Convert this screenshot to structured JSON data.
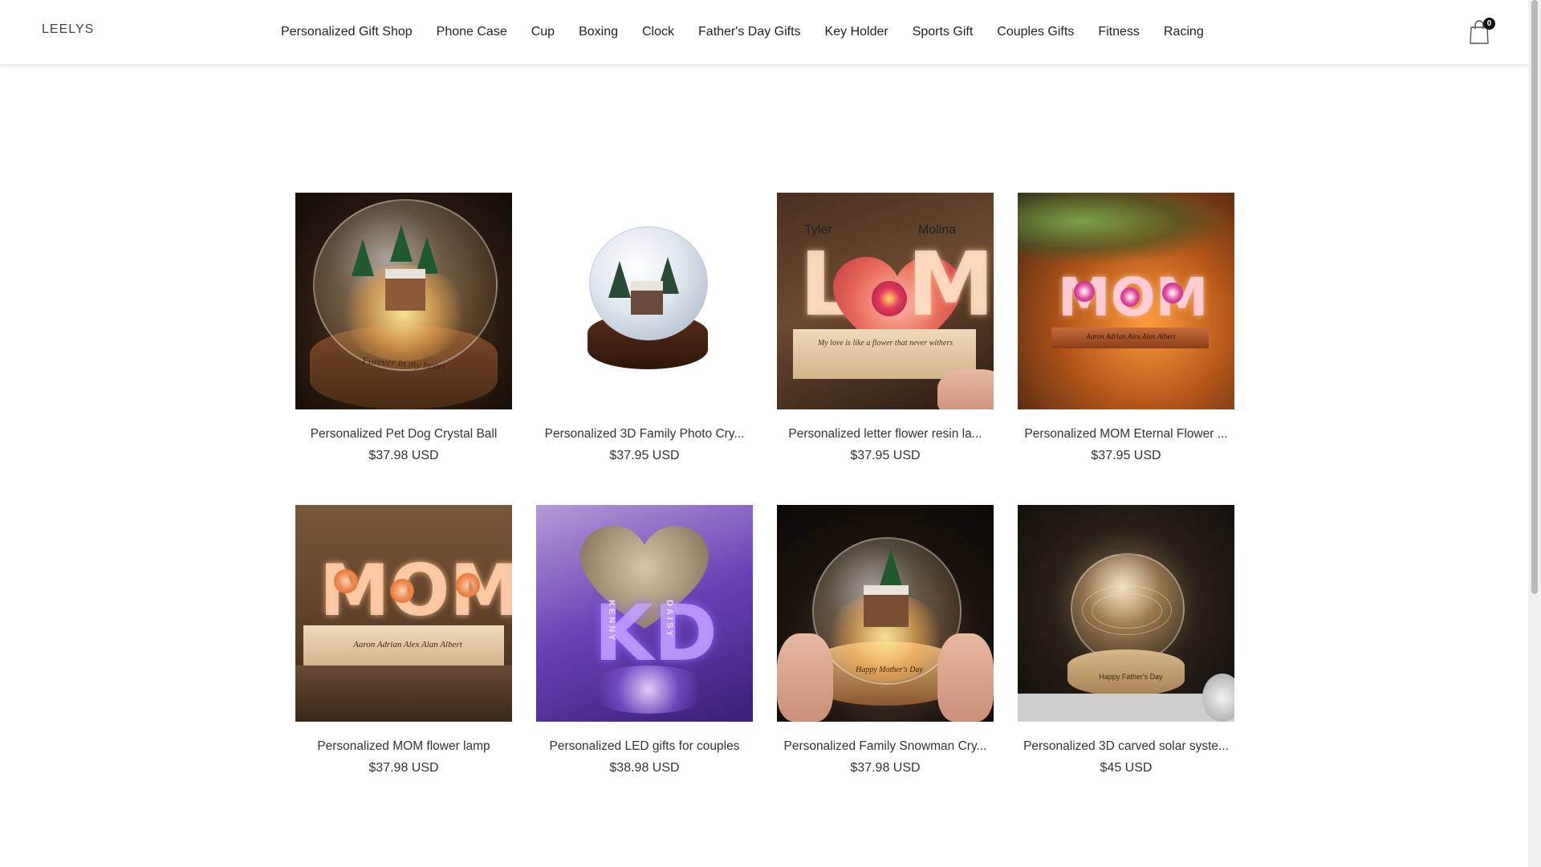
{
  "header": {
    "logo": "LEELYS",
    "nav": [
      "Personalized Gift Shop",
      "Phone Case",
      "Cup",
      "Boxing",
      "Clock",
      "Father's Day Gifts",
      "Key Holder",
      "Sports Gift",
      "Couples Gifts",
      "Fitness",
      "Racing"
    ],
    "cart_count": "0",
    "cart_icon": "shopping-bag-icon"
  },
  "products": [
    {
      "title": "Personalized Pet Dog Crystal Ball",
      "price": "$37.98 USD",
      "image_text": "Forever in my heart"
    },
    {
      "title": "Personalized 3D Family Photo Cry...",
      "price": "$37.95 USD"
    },
    {
      "title": "Personalized letter flower resin la...",
      "price": "$37.95 USD",
      "image_text": {
        "name1": "Tyler",
        "name2": "Molina",
        "caption": "My love is like a flower that never withers",
        "letter1": "L",
        "letter2": "M"
      }
    },
    {
      "title": "Personalized MOM Eternal Flower ...",
      "price": "$37.95 USD",
      "image_text": {
        "word": "MOM",
        "names": "Aaron Adrian Alex Alan Albert"
      }
    },
    {
      "title": "Personalized MOM flower lamp",
      "price": "$37.98 USD",
      "image_text": {
        "word": "MOM",
        "names": "Aaron Adrian Alex Alan Albert"
      }
    },
    {
      "title": "Personalized LED gifts for couples",
      "price": "$38.98 USD",
      "image_text": {
        "letters": "KD",
        "name1": "KENNY",
        "name2": "DAISY"
      }
    },
    {
      "title": "Personalized Family Snowman Cry...",
      "price": "$37.98 USD",
      "image_text": "Happy Mother's Day"
    },
    {
      "title": "Personalized 3D carved solar syste...",
      "price": "$45 USD",
      "image_text": "Happy Father's Day"
    }
  ],
  "colors": {
    "background": "#ffffff",
    "text": "#333333",
    "header_border": "#e6e6e6",
    "badge": "#111111"
  }
}
